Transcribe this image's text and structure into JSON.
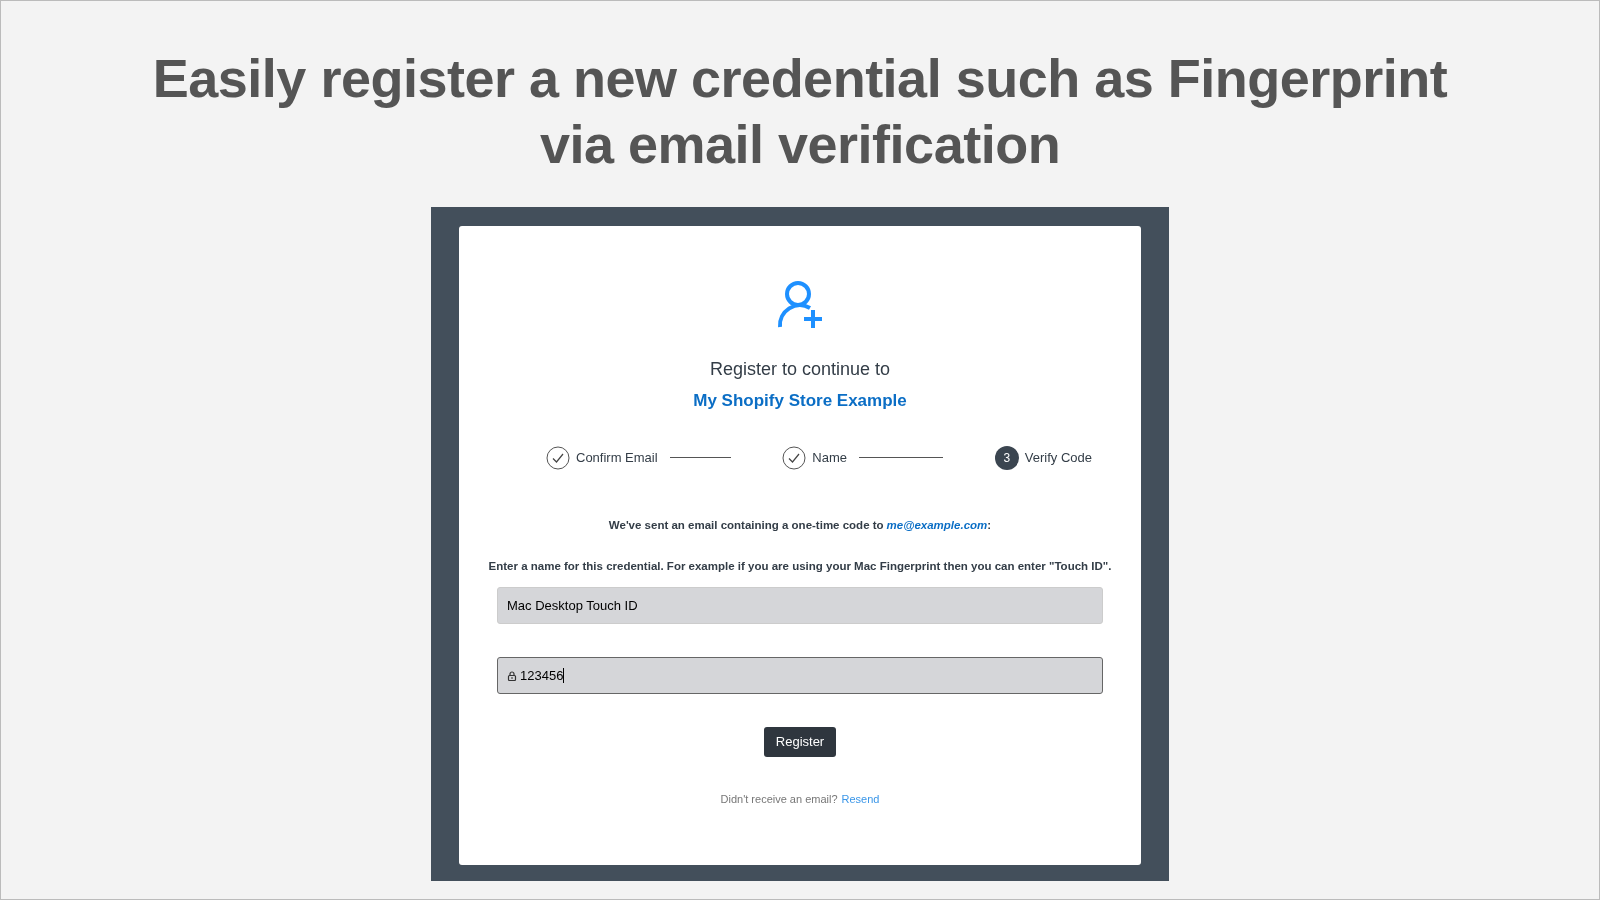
{
  "headline": "Easily register a new credential such as Fingerprint via email verification",
  "register": {
    "title": "Register to continue to",
    "store": "My Shopify Store Example",
    "steps": [
      {
        "kind": "done",
        "label": "Confirm Email"
      },
      {
        "kind": "done",
        "label": "Name"
      },
      {
        "kind": "current",
        "number": "3",
        "label": "Verify Code"
      }
    ],
    "sent_message": {
      "text": "We've sent an email containing a one-time code to",
      "email": "me@example.com",
      "suffix": ":"
    },
    "hint": "Enter a name for this credential. For example if you are using your Mac Fingerprint then you can enter \"Touch ID\".",
    "name_field": {
      "value": "Mac Desktop Touch ID",
      "focused": false
    },
    "code_field": {
      "value": "123456",
      "focused": true
    },
    "button": "Register",
    "resend": {
      "text": "Didn't receive an email?",
      "link": "Resend"
    }
  }
}
